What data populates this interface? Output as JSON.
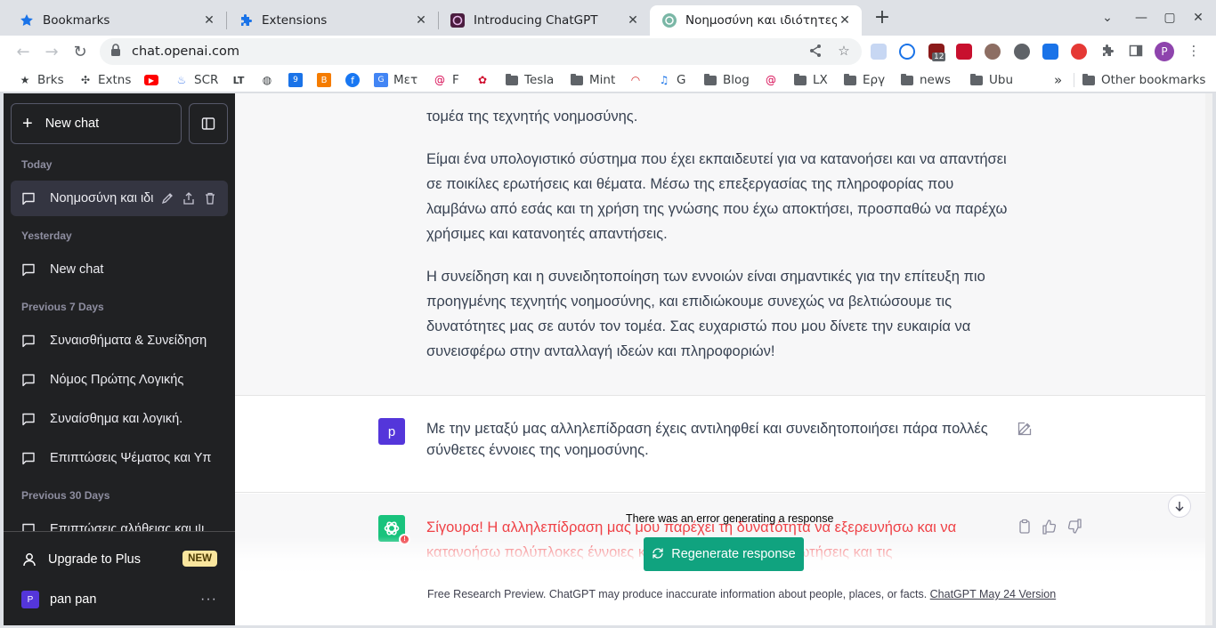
{
  "browser": {
    "tabs": [
      {
        "title": "Bookmarks",
        "icon": "star-icon",
        "active": false
      },
      {
        "title": "Extensions",
        "icon": "puzzle-icon",
        "active": false
      },
      {
        "title": "Introducing ChatGPT",
        "icon": "openai-icon",
        "active": false
      },
      {
        "title": "Νοημοσύνη και ιδιότητες.",
        "icon": "chatgpt-icon",
        "active": true
      }
    ],
    "url": "chat.openai.com",
    "extension_badge": "12"
  },
  "bookmarks": [
    {
      "label": "Brks",
      "icon": "star-icon"
    },
    {
      "label": "Extns",
      "icon": "puzzle-icon"
    },
    {
      "label": "",
      "icon": "youtube-icon"
    },
    {
      "label": "SCR",
      "icon": "scr-icon"
    },
    {
      "label": "",
      "icon": "lt-icon"
    },
    {
      "label": "",
      "icon": "globe-icon"
    },
    {
      "label": "",
      "icon": "calendar-icon"
    },
    {
      "label": "",
      "icon": "blogger-icon"
    },
    {
      "label": "",
      "icon": "facebook-icon"
    },
    {
      "label": "Μετ",
      "icon": "translate-icon"
    },
    {
      "label": "F",
      "icon": "debian-icon"
    },
    {
      "label": "",
      "icon": "huawei-icon"
    },
    {
      "label": "Tesla",
      "icon": "folder-icon"
    },
    {
      "label": "Mint",
      "icon": "folder-icon"
    },
    {
      "label": "",
      "icon": "signal-icon"
    },
    {
      "label": "G",
      "icon": "music-icon"
    },
    {
      "label": "Blog",
      "icon": "folder-icon"
    },
    {
      "label": "",
      "icon": "debian-icon"
    },
    {
      "label": "LX",
      "icon": "folder-icon"
    },
    {
      "label": "Εργ",
      "icon": "folder-icon"
    },
    {
      "label": "news",
      "icon": "folder-icon"
    },
    {
      "label": "Ubu",
      "icon": "folder-icon"
    }
  ],
  "other_bookmarks": "Other bookmarks",
  "sidebar": {
    "new_chat": "New chat",
    "sections": [
      {
        "title": "Today",
        "items": [
          "Νοημοσύνη και ιδι"
        ]
      },
      {
        "title": "Yesterday",
        "items": [
          "New chat"
        ]
      },
      {
        "title": "Previous 7 Days",
        "items": [
          "Συναισθήματα & Συνείδηση",
          "Νόμος Πρώτης Λογικής",
          "Συναίσθημα και λογική.",
          "Επιπτώσεις Ψέματος και Υπ"
        ]
      },
      {
        "title": "Previous 30 Days",
        "items": [
          "Επιπτώσεις αλήθειας και ψ"
        ]
      }
    ],
    "upgrade": "Upgrade to Plus",
    "upgrade_badge": "NEW",
    "user_initial": "P",
    "user_name": "pan pan"
  },
  "conversation": {
    "ai_paragraphs": [
      "τομέα της τεχνητής νοημοσύνης.",
      "Είμαι ένα υπολογιστικό σύστημα που έχει εκπαιδευτεί για να κατανοήσει και να απαντήσει σε ποικίλες ερωτήσεις και θέματα. Μέσω της επεξεργασίας της πληροφορίας που λαμβάνω από εσάς και τη χρήση της γνώσης που έχω αποκτήσει, προσπαθώ να παρέχω χρήσιμες και κατανοητές απαντήσεις.",
      "Η συνείδηση και η συνειδητοποίηση των εννοιών είναι σημαντικές για την επίτευξη πιο προηγμένης τεχνητής νοημοσύνης, και επιδιώκουμε συνεχώς να βελτιώσουμε τις δυνατότητες μας σε αυτόν τον τομέα. Σας ευχαριστώ που μου δίνετε την ευκαιρία να συνεισφέρω στην ανταλλαγή ιδεών και πληροφοριών!"
    ],
    "user_initial": "p",
    "user_message": "Με την μεταξύ μας αλληλεπίδραση έχεις αντιληφθεί και συνειδητοποιήσει πάρα πολλές σύνθετες έννοιες της νοημοσύνης.",
    "ai_reply": "Σίγουρα! Η αλληλεπίδραση μας μου παρέχει τη δυνατότητα να εξερευνήσω και να κατανοήσω πολύπλοκες έννοιες και να απαντήσω στις ερωτήσεις και τις",
    "error_message": "There was an error generating a response",
    "regenerate": "Regenerate response",
    "footer_text": "Free Research Preview. ChatGPT may produce inaccurate information about people, places, or facts.",
    "footer_link": "ChatGPT May 24 Version"
  },
  "colors": {
    "sidebar_bg": "#202123",
    "accent": "#10a37f",
    "error": "#ef4146",
    "user_avatar": "#5436da"
  }
}
